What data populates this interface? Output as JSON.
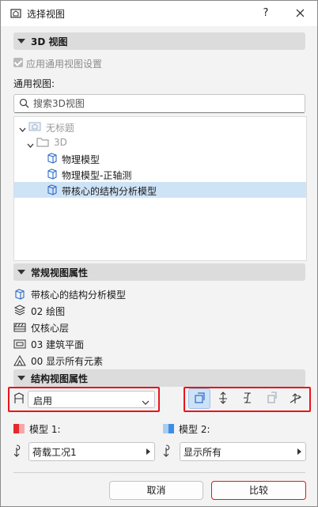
{
  "window": {
    "title": "选择视图",
    "help_glyph": "?",
    "close_glyph": "✕"
  },
  "section_3d": {
    "title": "3D 视图"
  },
  "apply_common_settings": {
    "label": "应用通用视图设置",
    "checked": true,
    "disabled": true
  },
  "common_views_label": "通用视图:",
  "search": {
    "placeholder": "搜索3D视图",
    "value": ""
  },
  "tree": {
    "items": [
      {
        "label": "无标题",
        "level": 0,
        "expanded": true,
        "icon": "view-set-icon",
        "disabled": true
      },
      {
        "label": "3D",
        "level": 1,
        "expanded": true,
        "icon": "folder-icon",
        "disabled": true
      },
      {
        "label": "物理模型",
        "level": 2,
        "icon": "cube-view-icon"
      },
      {
        "label": "物理模型-正轴测",
        "level": 2,
        "icon": "cube-view-icon"
      },
      {
        "label": "带核心的结构分析模型",
        "level": 2,
        "icon": "cube-view-icon",
        "selected": true
      }
    ]
  },
  "section_general_props": {
    "title": "常规视图属性",
    "rows": [
      {
        "icon": "view-icon",
        "text": "带核心的结构分析模型"
      },
      {
        "icon": "layer-combination-icon",
        "text": "02 绘图"
      },
      {
        "icon": "partial-structure-icon",
        "text": "仅核心层"
      },
      {
        "icon": "model-view-icon",
        "text": "03 建筑平面"
      },
      {
        "icon": "filter-elements-icon",
        "text": "00 显示所有元素"
      }
    ]
  },
  "section_struct_props": {
    "title": "结构视图属性",
    "enable_select": {
      "value": "启用"
    }
  },
  "model1": {
    "label": "模型 1:",
    "color": "#e8282c",
    "value": "荷载工况1"
  },
  "model2": {
    "label": "模型 2:",
    "color": "#3b8ee8",
    "value": "显示所有"
  },
  "buttons": {
    "cancel": "取消",
    "compare": "比较"
  },
  "colors": {
    "highlight_border": "#e8141c",
    "selection": "#cfe3f7",
    "header_bg": "#dcdcdc"
  }
}
